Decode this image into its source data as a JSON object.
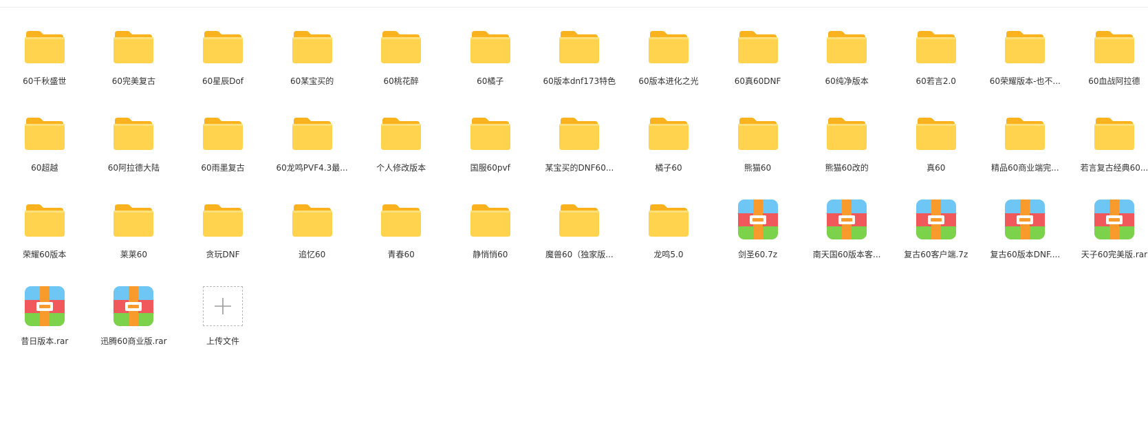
{
  "colors": {
    "folder_front": "#FFD34D",
    "folder_back": "#FBB21F",
    "text": "#333333"
  },
  "files": [
    {
      "name": "60千秋盛世",
      "type": "folder"
    },
    {
      "name": "60完美复古",
      "type": "folder"
    },
    {
      "name": "60星辰Dof",
      "type": "folder"
    },
    {
      "name": "60某宝买的",
      "type": "folder"
    },
    {
      "name": "60桃花醉",
      "type": "folder"
    },
    {
      "name": "60橘子",
      "type": "folder"
    },
    {
      "name": "60版本dnf173特色",
      "type": "folder"
    },
    {
      "name": "60版本进化之光",
      "type": "folder"
    },
    {
      "name": "60真60DNF",
      "type": "folder"
    },
    {
      "name": "60纯净版本",
      "type": "folder"
    },
    {
      "name": "60若言2.0",
      "type": "folder"
    },
    {
      "name": "60荣耀版本-也不...",
      "type": "folder"
    },
    {
      "name": "60血战阿拉德",
      "type": "folder"
    },
    {
      "name": "60超越",
      "type": "folder"
    },
    {
      "name": "60阿拉德大陆",
      "type": "folder"
    },
    {
      "name": "60雨墨复古",
      "type": "folder"
    },
    {
      "name": "60龙鸣PVF4.3最...",
      "type": "folder"
    },
    {
      "name": "个人修改版本",
      "type": "folder"
    },
    {
      "name": "国服60pvf",
      "type": "folder"
    },
    {
      "name": "某宝买的DNF60...",
      "type": "folder"
    },
    {
      "name": "橘子60",
      "type": "folder"
    },
    {
      "name": "熊猫60",
      "type": "folder"
    },
    {
      "name": "熊猫60改的",
      "type": "folder"
    },
    {
      "name": "真60",
      "type": "folder"
    },
    {
      "name": "精品60商业端完...",
      "type": "folder"
    },
    {
      "name": "若言复古经典60...",
      "type": "folder"
    },
    {
      "name": "荣耀60版本",
      "type": "folder"
    },
    {
      "name": "莱莱60",
      "type": "folder"
    },
    {
      "name": "贪玩DNF",
      "type": "folder"
    },
    {
      "name": "追忆60",
      "type": "folder"
    },
    {
      "name": "青春60",
      "type": "folder"
    },
    {
      "name": "静悄悄60",
      "type": "folder"
    },
    {
      "name": "魔兽60（独家版...",
      "type": "folder"
    },
    {
      "name": "龙鸣5.0",
      "type": "folder"
    },
    {
      "name": "剑圣60.7z",
      "type": "archive"
    },
    {
      "name": "南天国60版本客...",
      "type": "archive"
    },
    {
      "name": "复古60客户端.7z",
      "type": "archive"
    },
    {
      "name": "复古60版本DNF....",
      "type": "archive"
    },
    {
      "name": "天子60完美版.rar",
      "type": "archive"
    },
    {
      "name": "昔日版本.rar",
      "type": "archive"
    },
    {
      "name": "迅腾60商业版.rar",
      "type": "archive"
    }
  ],
  "upload": {
    "label": "上传文件"
  }
}
